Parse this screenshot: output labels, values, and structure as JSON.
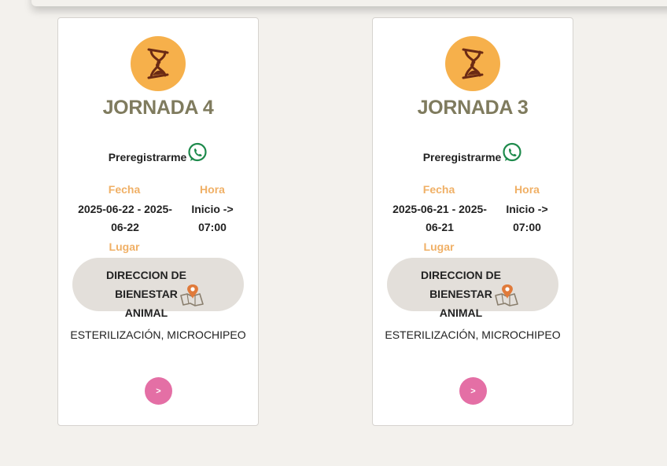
{
  "cards": [
    {
      "title": "JORNADA 4",
      "prereg_label": "Preregistrarme",
      "fecha_label": "Fecha",
      "fecha_value_line1": "2025-06-22 - 2025-",
      "fecha_value_line2": "06-22",
      "hora_label": "Hora",
      "hora_value_line1": "Inicio ->",
      "hora_value_line2": "07:00",
      "lugar_label": "Lugar",
      "lugar_line1": "DIRECCION DE BIENESTAR",
      "lugar_line2": "ANIMAL",
      "description": "ESTERILIZACIÓN, MICROCHIPEO",
      "next_label": ">"
    },
    {
      "title": "JORNADA 3",
      "prereg_label": "Preregistrarme",
      "fecha_label": "Fecha",
      "fecha_value_line1": "2025-06-21 - 2025-",
      "fecha_value_line2": "06-21",
      "hora_label": "Hora",
      "hora_value_line1": "Inicio ->",
      "hora_value_line2": "07:00",
      "lugar_label": "Lugar",
      "lugar_line1": "DIRECCION DE BIENESTAR",
      "lugar_line2": "ANIMAL",
      "description": "ESTERILIZACIÓN, MICROCHIPEO",
      "next_label": ">"
    }
  ],
  "icons": {
    "badge": "hourglass-icon",
    "whatsapp": "whatsapp-icon",
    "map": "map-pin-icon"
  },
  "colors": {
    "badge": "#f6b04b",
    "title": "#7f7b5e",
    "label": "#f0b066",
    "place_bg": "#e3dfda",
    "button": "#e46fa5",
    "whatsapp": "#1e8a4c",
    "map_pin": "#e07a3a"
  }
}
